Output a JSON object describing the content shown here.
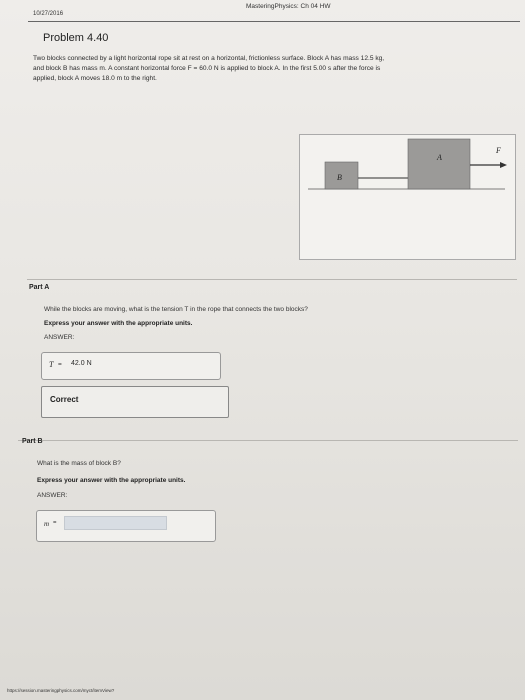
{
  "header": {
    "date": "10/27/2016",
    "title": "MasteringPhysics: Ch 04 HW"
  },
  "problem": {
    "title": "Problem 4.40",
    "text_line1": "Two blocks connected by a light horizontal rope sit at rest on a horizontal, frictionless surface. Block A has mass 12.5 kg,",
    "text_line2": "and block B has mass m. A constant horizontal force F = 60.0 N is applied to block A. In the first 5.00 s after the force is",
    "text_line3": "applied, block A moves 18.0 m to the right."
  },
  "figure": {
    "label_a": "A",
    "label_b": "B",
    "label_f": "F"
  },
  "part_a": {
    "heading": "Part A",
    "question": "While the blocks are moving, what is the tension T in the rope that connects the two blocks?",
    "instruction": "Express your answer with the appropriate units.",
    "answer_label": "ANSWER:",
    "answer_var": "T",
    "answer_eq": "=",
    "answer_value": "42.0 N",
    "feedback": "Correct"
  },
  "part_b": {
    "heading": "Part B",
    "question": "What is the mass of block B?",
    "instruction": "Express your answer with the appropriate units.",
    "answer_label": "ANSWER:",
    "answer_var": "m",
    "answer_eq": "=",
    "answer_value": ""
  },
  "footer": {
    "url": "https://session.masteringphysics.com/myct/itemView?"
  }
}
